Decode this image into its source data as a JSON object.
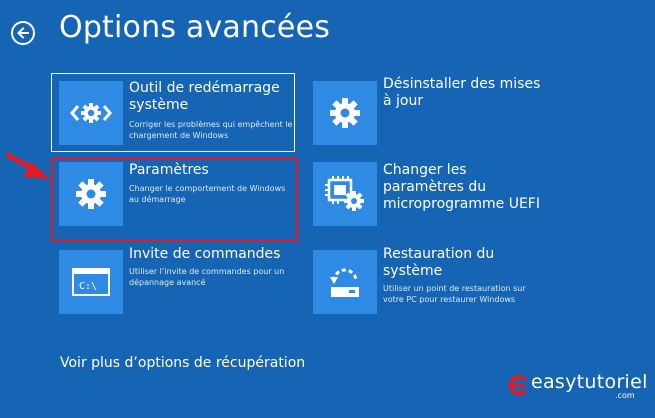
{
  "header": {
    "title": "Options avancées",
    "back_icon": "back-arrow-icon"
  },
  "tiles": [
    {
      "title": "Outil de redémarrage système",
      "description": "Corriger les problèmes qui empêchent le chargement de Windows",
      "icon": "code-gear-icon",
      "selected": true
    },
    {
      "title": "Désinstaller des mises à jour",
      "description": "",
      "icon": "gear-icon"
    },
    {
      "title": "Paramètres",
      "description": "Changer le comportement de Windows au démarrage",
      "icon": "gear-icon",
      "highlighted": true
    },
    {
      "title": "Changer les paramètres du microprogramme UEFI",
      "description": "",
      "icon": "chip-gear-icon"
    },
    {
      "title": "Invite de commandes",
      "description": "Utiliser l’invite de commandes pour un dépannage avancé",
      "icon": "terminal-icon"
    },
    {
      "title": "Restauration du système",
      "description": "Utiliser un point de restauration sur votre PC pour restaurer Windows",
      "icon": "restore-icon"
    }
  ],
  "footer": {
    "more_options": "Voir plus d’options de récupération"
  },
  "watermark": {
    "text": "easytutoriel",
    "suffix": ".com"
  },
  "colors": {
    "background": "#1565b4",
    "tile_icon_bg": "#2f8ae3",
    "highlight": "#e11b22"
  }
}
